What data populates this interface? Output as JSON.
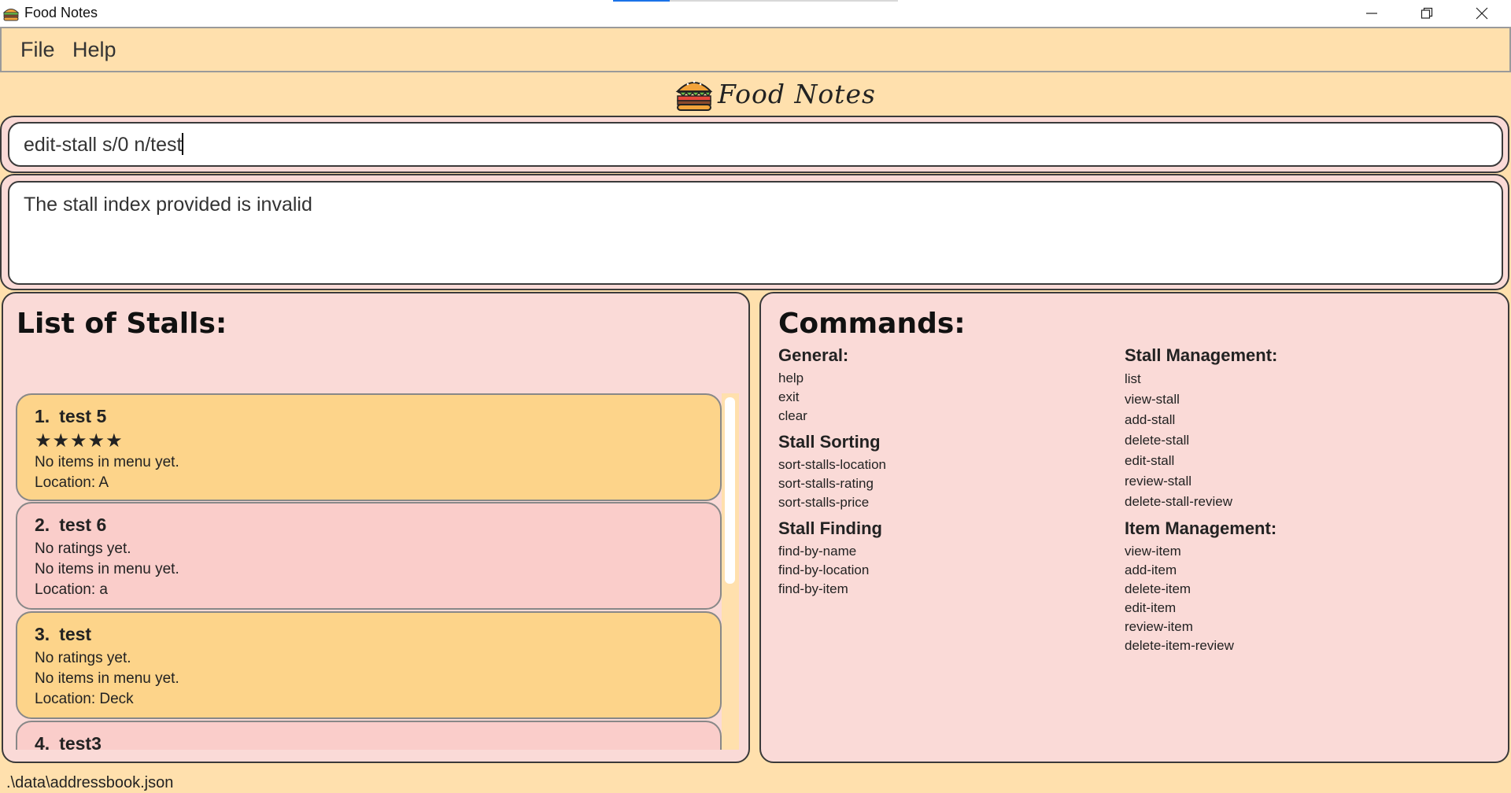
{
  "window": {
    "title": "Food Notes"
  },
  "menu": {
    "items": [
      "File",
      "Help"
    ]
  },
  "logo": {
    "text": "Food Notes"
  },
  "command_box": {
    "value": "edit-stall s/0 n/test"
  },
  "result_box": {
    "message": "The stall index provided is invalid"
  },
  "stalls_panel": {
    "title": "List of Stalls:",
    "stalls": [
      {
        "index": "1.",
        "name": "test 5",
        "rating": "★★★★★",
        "menu": "No items in menu yet.",
        "location": "Location: A"
      },
      {
        "index": "2.",
        "name": "test 6",
        "rating": "No ratings yet.",
        "menu": "No items in menu yet.",
        "location": "Location: a"
      },
      {
        "index": "3.",
        "name": "test",
        "rating": "No ratings yet.",
        "menu": "No items in menu yet.",
        "location": "Location: Deck"
      },
      {
        "index": "4.",
        "name": "test3"
      }
    ]
  },
  "commands_panel": {
    "title": "Commands:",
    "left_groups": [
      {
        "heading": "General:",
        "items": [
          "help",
          "exit",
          "clear"
        ]
      },
      {
        "heading": "Stall Sorting",
        "items": [
          "sort-stalls-location",
          "sort-stalls-rating",
          "sort-stalls-price"
        ]
      },
      {
        "heading": "Stall Finding",
        "items": [
          "find-by-name",
          "find-by-location",
          "find-by-item"
        ]
      }
    ],
    "right_groups": [
      {
        "heading": "Stall Management:",
        "items": [
          "list",
          "view-stall",
          "add-stall",
          "delete-stall",
          "edit-stall",
          "review-stall",
          "delete-stall-review"
        ]
      },
      {
        "heading": "Item Management:",
        "items": [
          "view-item",
          "add-item",
          "delete-item",
          "edit-item",
          "review-item",
          "delete-item-review"
        ]
      }
    ]
  },
  "status_bar": {
    "path": ".\\data\\addressbook.json"
  },
  "colors": {
    "background": "#ffe0ad",
    "panel": "#fadad7",
    "card_odd": "#fdd48a",
    "card_even": "#facdca"
  }
}
